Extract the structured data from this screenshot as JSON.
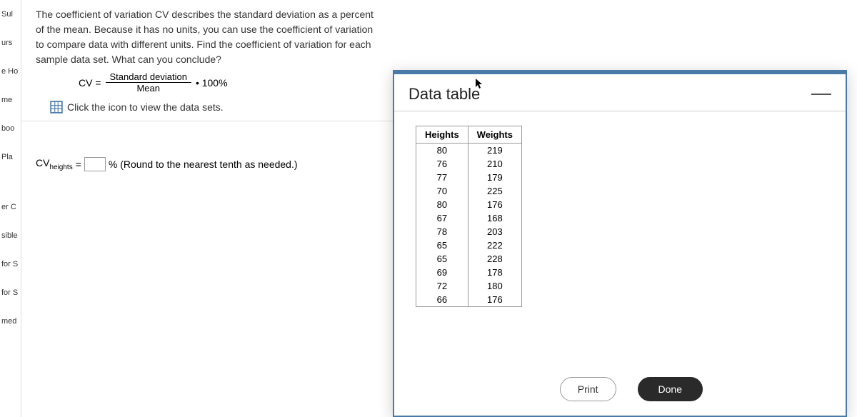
{
  "sidebar": {
    "items": [
      {
        "label": "Sul"
      },
      {
        "label": "urs"
      },
      {
        "label": "e Ho"
      },
      {
        "label": "me"
      },
      {
        "label": "boo"
      },
      {
        "label": "Pla"
      },
      {
        "label": "er C"
      },
      {
        "label": "sible"
      },
      {
        "label": "for S"
      },
      {
        "label": "for S"
      },
      {
        "label": "med"
      }
    ]
  },
  "question": {
    "text": "The coefficient of variation CV describes the standard deviation as a percent of the mean. Because it has no units, you can use the coefficient of variation to compare data with different units. Find the coefficient of variation for each sample data set. What can you conclude?",
    "cv_formula_label": "CV =",
    "cv_formula_num": "Standard deviation",
    "cv_formula_den": "Mean",
    "cv_formula_mult": "• 100%",
    "data_link": "Click the icon to view the data sets.",
    "answer_prefix": "CV",
    "answer_sub": "heights",
    "answer_equals": "=",
    "answer_suffix": "% (Round to the nearest tenth as needed.)"
  },
  "modal": {
    "title": "Data table",
    "print_label": "Print",
    "done_label": "Done",
    "columns": [
      "Heights",
      "Weights"
    ],
    "rows": [
      {
        "h": "80",
        "w": "219"
      },
      {
        "h": "76",
        "w": "210"
      },
      {
        "h": "77",
        "w": "179"
      },
      {
        "h": "70",
        "w": "225"
      },
      {
        "h": "80",
        "w": "176"
      },
      {
        "h": "67",
        "w": "168"
      },
      {
        "h": "78",
        "w": "203"
      },
      {
        "h": "65",
        "w": "222"
      },
      {
        "h": "65",
        "w": "228"
      },
      {
        "h": "69",
        "w": "178"
      },
      {
        "h": "72",
        "w": "180"
      },
      {
        "h": "66",
        "w": "176"
      }
    ]
  }
}
